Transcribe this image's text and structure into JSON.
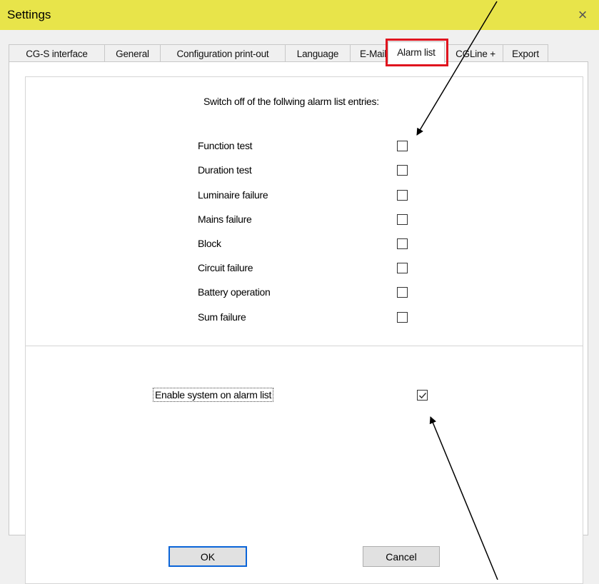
{
  "window": {
    "title": "Settings",
    "close_glyph": "×"
  },
  "tabs": [
    {
      "label": "CG-S interface"
    },
    {
      "label": "General"
    },
    {
      "label": "Configuration print-out"
    },
    {
      "label": "Language"
    },
    {
      "label": "E-Mail"
    },
    {
      "label": "Alarm list",
      "active": true
    },
    {
      "label": "CGLine +"
    },
    {
      "label": "Export"
    }
  ],
  "alarm_list": {
    "heading": "Switch off of the follwing alarm list entries:",
    "entries": [
      {
        "label": "Function test",
        "checked": false
      },
      {
        "label": "Duration test",
        "checked": false
      },
      {
        "label": "Luminaire failure",
        "checked": false
      },
      {
        "label": "Mains failure",
        "checked": false
      },
      {
        "label": "Block",
        "checked": false
      },
      {
        "label": "Circuit failure",
        "checked": false
      },
      {
        "label": "Battery operation",
        "checked": false
      },
      {
        "label": "Sum failure",
        "checked": false
      }
    ],
    "enable_system": {
      "label": "Enable system on alarm list",
      "checked": true
    }
  },
  "buttons": {
    "ok": "OK",
    "cancel": "Cancel"
  },
  "colors": {
    "titlebar": "#e8e44a",
    "highlight": "#e0141e",
    "ok_border": "#0a64d8"
  }
}
